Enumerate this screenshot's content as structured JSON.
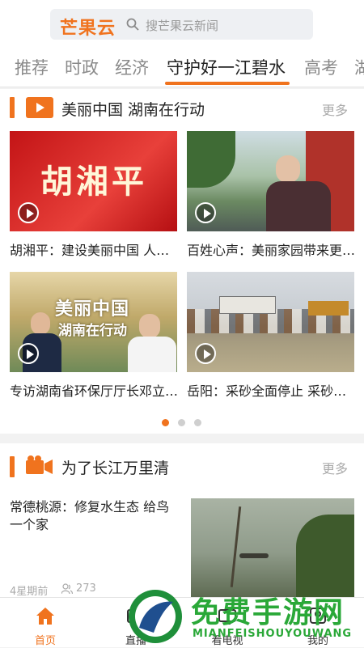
{
  "search": {
    "logo_text": "芒果云",
    "placeholder": "搜芒果云新闻"
  },
  "tabs": [
    {
      "label": "推荐",
      "active": false
    },
    {
      "label": "时政",
      "active": false
    },
    {
      "label": "经济",
      "active": false
    },
    {
      "label": "守护好一江碧水",
      "active": true
    },
    {
      "label": "高考",
      "active": false
    },
    {
      "label": "湖",
      "active": false
    }
  ],
  "section1": {
    "title": "美丽中国 湖南在行动",
    "more": "更多",
    "items": [
      {
        "caption": "胡湘平：建设美丽中国 人…",
        "thumb_text": "胡湘平"
      },
      {
        "caption": "百姓心声：美丽家园带来更…"
      },
      {
        "caption": "专访湖南省环保厅厅长邓立…",
        "thumb_text_1": "美丽中国",
        "thumb_text_2": "湖南在行动"
      },
      {
        "caption": "岳阳：采砂全面停止 采砂…"
      }
    ],
    "pager": {
      "count": 3,
      "active_index": 0
    }
  },
  "section2": {
    "title": "为了长江万里清",
    "more": "更多",
    "article": {
      "title": "常德桃源：修复水生态 给鸟一个家",
      "time": "4星期前",
      "views": "273"
    }
  },
  "bottom_nav": [
    {
      "label": "首页",
      "icon": "home-icon",
      "active": true
    },
    {
      "label": "直播",
      "icon": "live-icon",
      "active": false
    },
    {
      "label": "看电视",
      "icon": "tv-icon",
      "active": false
    },
    {
      "label": "我的",
      "icon": "user-icon",
      "active": false
    }
  ],
  "watermark": {
    "title": "免费手游网",
    "subtitle": "MIANFEISHOUYOUWANG"
  },
  "colors": {
    "accent": "#f0731e",
    "watermark": "#2aa838"
  }
}
